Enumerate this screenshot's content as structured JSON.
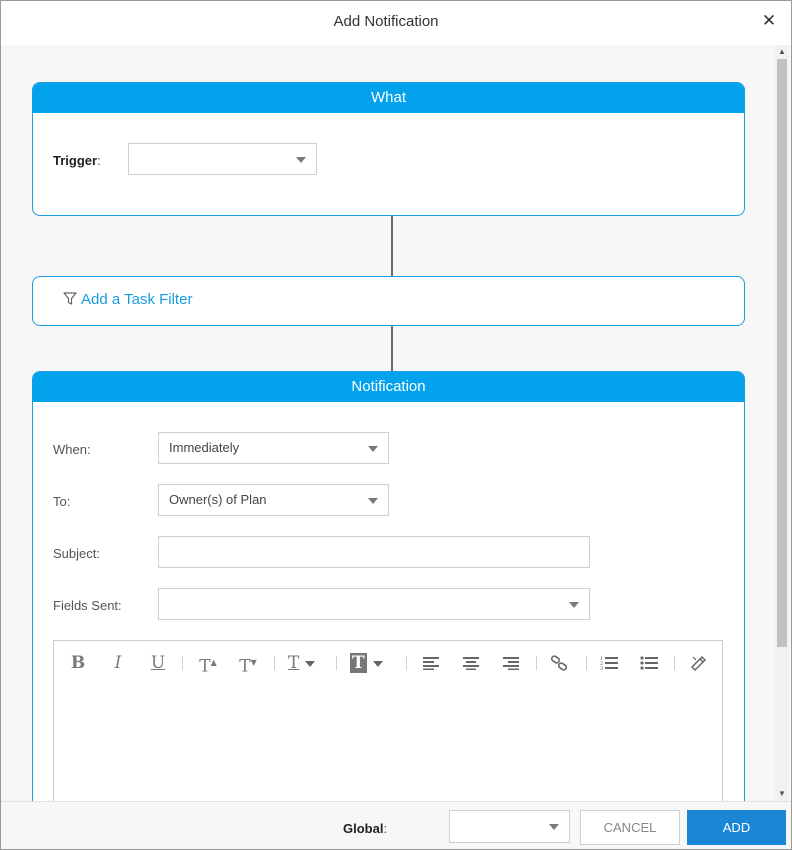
{
  "dialog": {
    "title": "Add Notification",
    "close_icon": "close-icon"
  },
  "what_panel": {
    "header": "What",
    "trigger_label": "Trigger",
    "trigger_colon": ":",
    "trigger_value": ""
  },
  "filter_panel": {
    "link_label": "Add a Task Filter",
    "icon": "filter-icon"
  },
  "notification_panel": {
    "header": "Notification",
    "when_label": "When:",
    "when_value": "Immediately",
    "to_label": "To:",
    "to_value": "Owner(s) of Plan",
    "subject_label": "Subject:",
    "subject_value": "",
    "fields_sent_label": "Fields Sent:",
    "fields_sent_value": ""
  },
  "editor_toolbar": {
    "bold": "B",
    "italic": "I",
    "underline": "U",
    "superscript": "T",
    "subscript": "T",
    "text_color": "T",
    "background_color": "T",
    "icons": [
      "bold-icon",
      "italic-icon",
      "underline-icon",
      "superscript-icon",
      "subscript-icon",
      "text-color-icon",
      "background-color-icon",
      "align-left-icon",
      "align-center-icon",
      "align-right-icon",
      "link-icon",
      "ordered-list-icon",
      "unordered-list-icon",
      "clear-format-icon"
    ]
  },
  "footer": {
    "global_label": "Global",
    "global_colon": ":",
    "global_value": "",
    "cancel_label": "CANCEL",
    "add_label": "ADD"
  },
  "colors": {
    "accent": "#02a2ec",
    "border_accent": "#1a9ce2",
    "add_button": "#1a86d6"
  }
}
